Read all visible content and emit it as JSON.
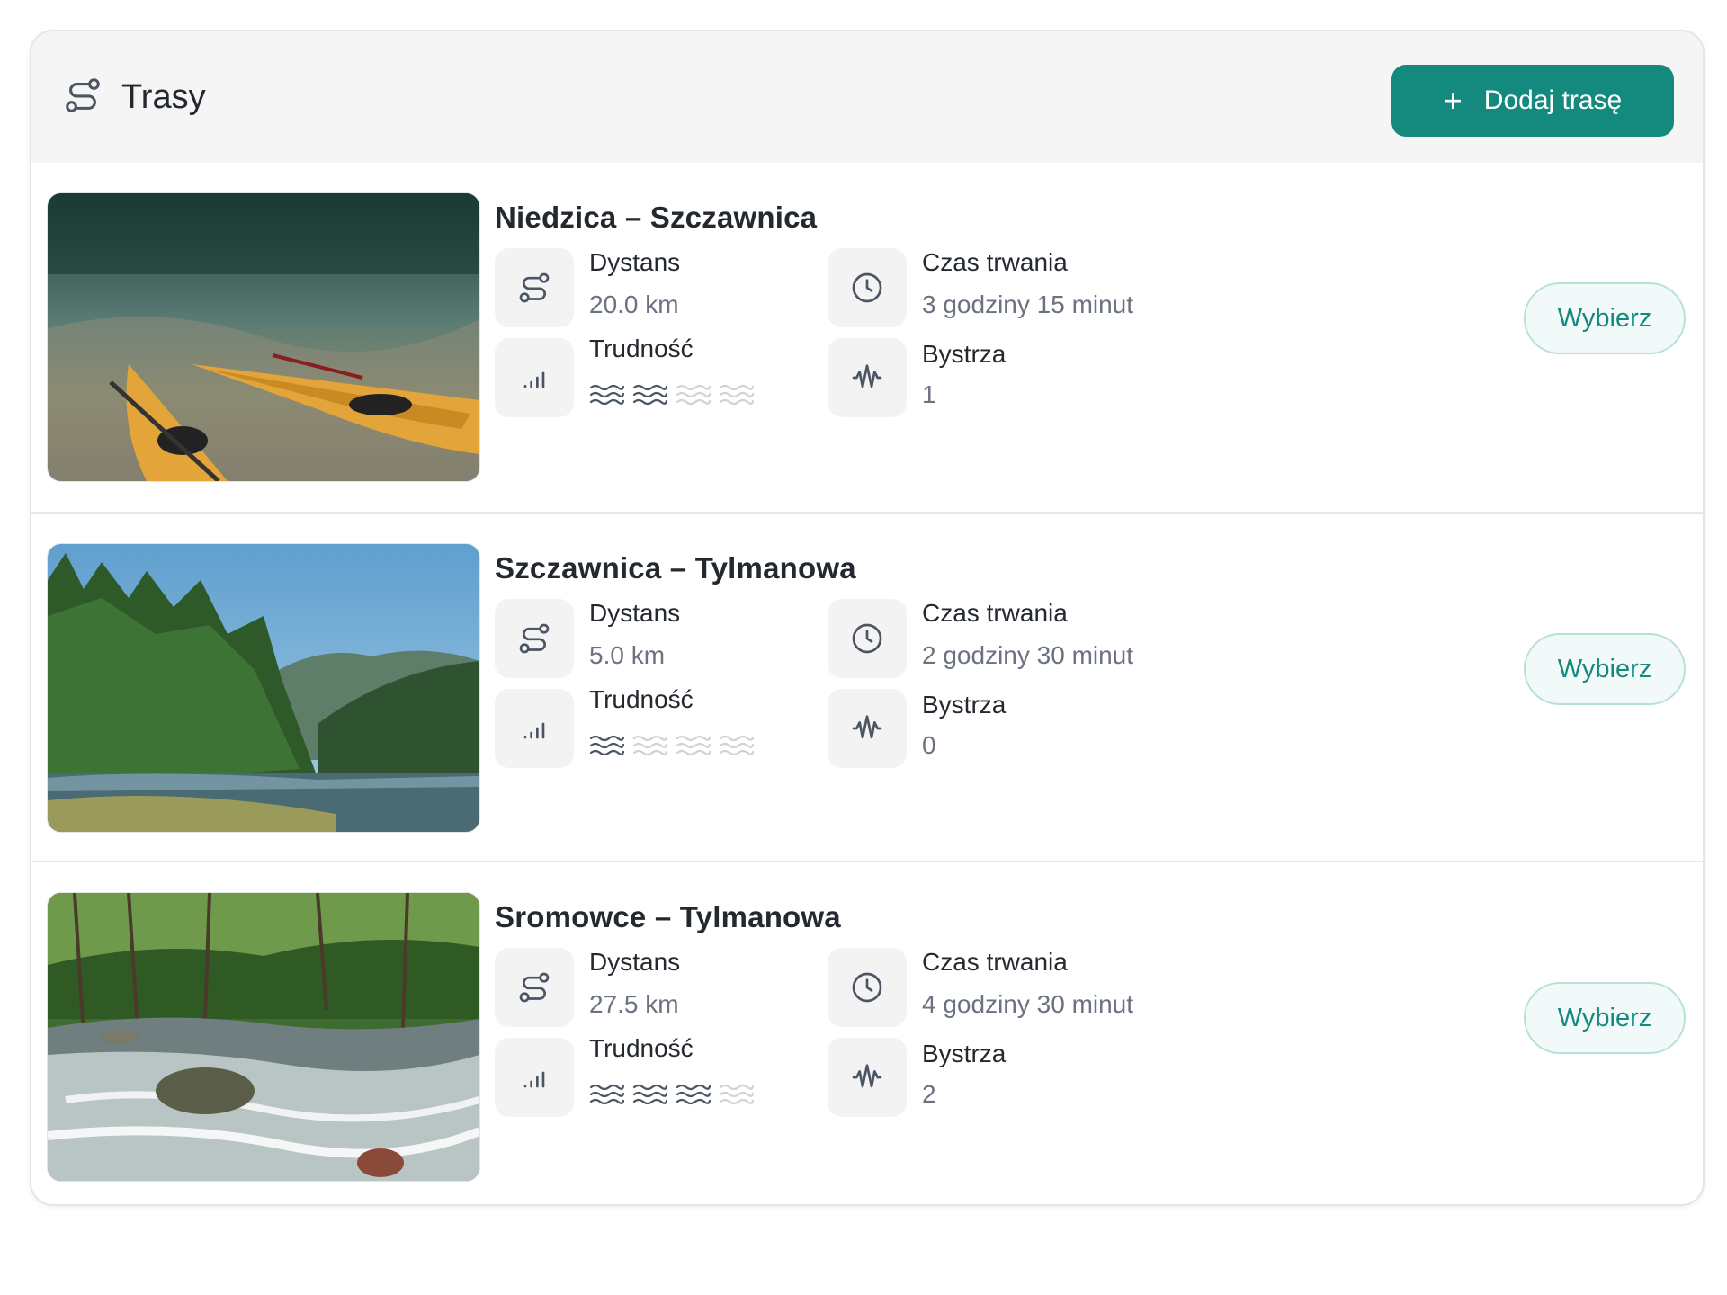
{
  "header": {
    "title": "Trasy",
    "title_icon": "route-icon",
    "add_button_label": "Dodaj trasę",
    "add_button_icon": "plus-icon"
  },
  "colors": {
    "accent": "#14897d",
    "header_bg": "#f5f5f5",
    "icon_box_bg": "#f3f3f3",
    "wave_active": "#4b5563",
    "wave_inactive": "#cfd3d8"
  },
  "labels": {
    "distance": "Dystans",
    "duration": "Czas trwania",
    "difficulty": "Trudność",
    "rapids": "Bystrza",
    "select": "Wybierz"
  },
  "routes": [
    {
      "name": "Niedzica – Szczawnica",
      "distance": "20.0 km",
      "duration": "3 godziny 15 minut",
      "difficulty_level": 2,
      "difficulty_max": 4,
      "rapids": "1",
      "image": "kayaks-on-lake-shore"
    },
    {
      "name": "Szczawnica – Tylmanowa",
      "distance": "5.0 km",
      "duration": "2 godziny 30 minut",
      "difficulty_level": 1,
      "difficulty_max": 4,
      "rapids": "0",
      "image": "forest-river-mountains"
    },
    {
      "name": "Sromowce – Tylmanowa",
      "distance": "27.5 km",
      "duration": "4 godziny 30 minut",
      "difficulty_level": 3,
      "difficulty_max": 4,
      "rapids": "2",
      "image": "rocky-forest-stream"
    }
  ],
  "icons": {
    "distance": "route-icon",
    "duration": "clock-icon",
    "difficulty": "signal-bars-icon",
    "rapids": "waveform-icon",
    "difficulty_level": "waves-icon"
  }
}
